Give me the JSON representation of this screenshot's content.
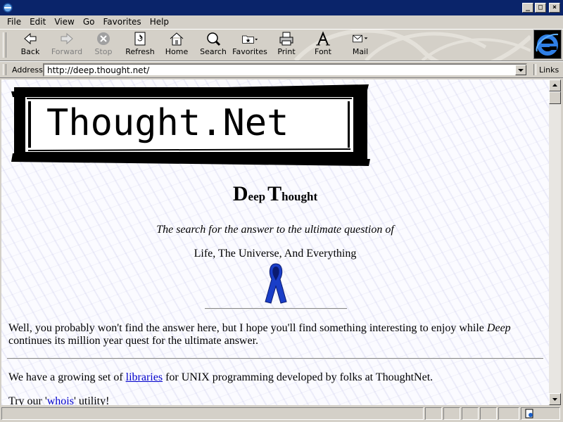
{
  "menu": {
    "file": "File",
    "edit": "Edit",
    "view": "View",
    "go": "Go",
    "favorites": "Favorites",
    "help": "Help"
  },
  "toolbar": {
    "back": "Back",
    "forward": "Forward",
    "stop": "Stop",
    "refresh": "Refresh",
    "home": "Home",
    "search": "Search",
    "favorites": "Favorites",
    "print": "Print",
    "font": "Font",
    "mail": "Mail"
  },
  "address": {
    "label": "Address",
    "url": "http://deep.thought.net/",
    "links_label": "Links"
  },
  "page": {
    "logo_text": "Thought.Net",
    "title_d": "D",
    "title_eep": "eep",
    "title_t": "T",
    "title_hought": "hought",
    "tagline": "The search for the answer to the ultimate question of",
    "subline": "Life, The Universe, And Everything",
    "intro_before": "Well, you probably won't find the answer here, but I hope you'll find something interesting to enjoy while ",
    "intro_em": "Deep",
    "intro_after": " continues its million year quest for the ultimate answer.",
    "libs_before": "We have a growing set of ",
    "libs_link": "libraries",
    "libs_after": " for UNIX programming developed by folks at ThoughtNet.",
    "whois_before": "Try our '",
    "whois_link": "whois",
    "whois_after": "' utility!"
  },
  "colors": {
    "titlebar": "#0a246a",
    "link": "#0000cc",
    "ribbon": "#1a3ec8"
  }
}
